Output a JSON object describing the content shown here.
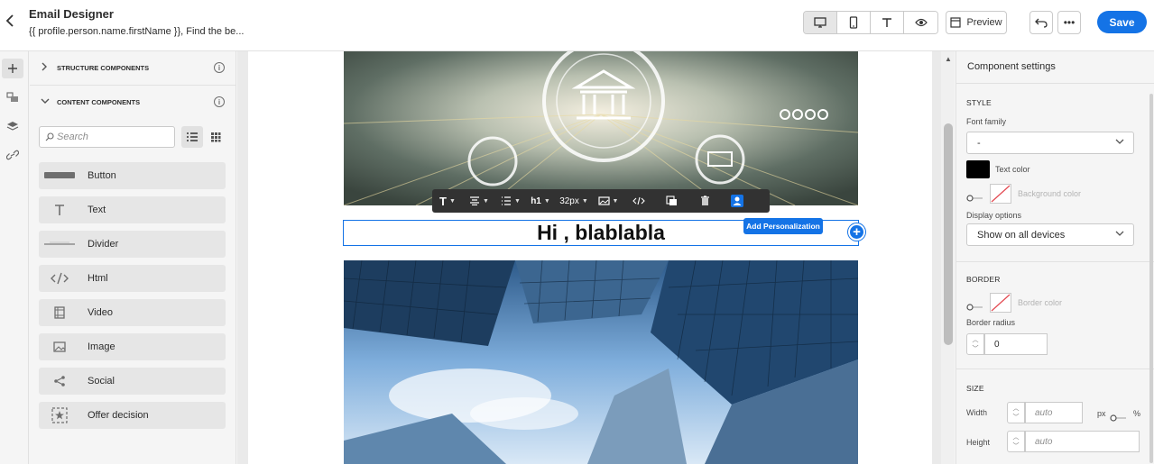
{
  "header": {
    "title": "Email Designer",
    "subtitle": "{{ profile.person.name.firstName }}, Find the be...",
    "preview_label": "Preview",
    "save_label": "Save"
  },
  "left_panel": {
    "structure_label": "STRUCTURE COMPONENTS",
    "content_label": "CONTENT COMPONENTS",
    "search_placeholder": "Search",
    "components": [
      {
        "label": "Button",
        "icon": "button-icon"
      },
      {
        "label": "Text",
        "icon": "text-icon"
      },
      {
        "label": "Divider",
        "icon": "divider-icon"
      },
      {
        "label": "Html",
        "icon": "code-icon"
      },
      {
        "label": "Video",
        "icon": "video-icon"
      },
      {
        "label": "Image",
        "icon": "image-icon"
      },
      {
        "label": "Social",
        "icon": "share-icon"
      },
      {
        "label": "Offer decision",
        "icon": "offer-decision-icon"
      }
    ]
  },
  "canvas": {
    "greeting_text": "Hi , blablabla",
    "toolbar_font_size": "32px",
    "tooltip": "Add Personalization"
  },
  "settings": {
    "title": "Component settings",
    "style_label": "STYLE",
    "font_family_label": "Font family",
    "font_family_value": "-",
    "text_color_label": "Text color",
    "text_color": "#000000",
    "background_color_label": "Background color",
    "display_options_label": "Display options",
    "display_options_value": "Show on all devices",
    "border_label": "BORDER",
    "border_color_label": "Border color",
    "border_radius_label": "Border radius",
    "border_radius_value": "0",
    "size_label": "SIZE",
    "width_label": "Width",
    "width_value": "auto",
    "unit_px": "px",
    "unit_pct": "%",
    "height_label": "Height",
    "height_value": "auto"
  },
  "colors": {
    "accent": "#1473e6"
  }
}
